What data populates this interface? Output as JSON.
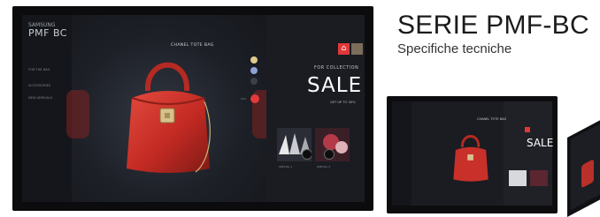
{
  "heading": {
    "title": "SERIE PMF-BC",
    "subtitle": "Specifiche tecniche"
  },
  "screen": {
    "brand_line1": "SAMSUNG",
    "brand_line2": "PMF BC",
    "menu": [
      "FOR THE BAG",
      "ACCESSORIES",
      "NEW ARRIVALS"
    ],
    "product_title": "CHANEL TOTE BAG",
    "swatches": [
      {
        "label": "",
        "color": "#e0c98a"
      },
      {
        "label": "",
        "color": "#8da1d6"
      },
      {
        "label": "",
        "color": "#3b3f48"
      },
      {
        "label": "RED",
        "color": "#e23a3a"
      }
    ],
    "collection": "FOR COLLECTION",
    "sale": "SALE",
    "offer": "GET UP TO 30%",
    "thumb_captions": [
      "SPECIAL 1",
      "SPECIAL 2"
    ],
    "accent": "#e03838"
  },
  "mini_screen": {
    "product_title": "CHANEL TOTE BAG",
    "sale": "SALE"
  }
}
